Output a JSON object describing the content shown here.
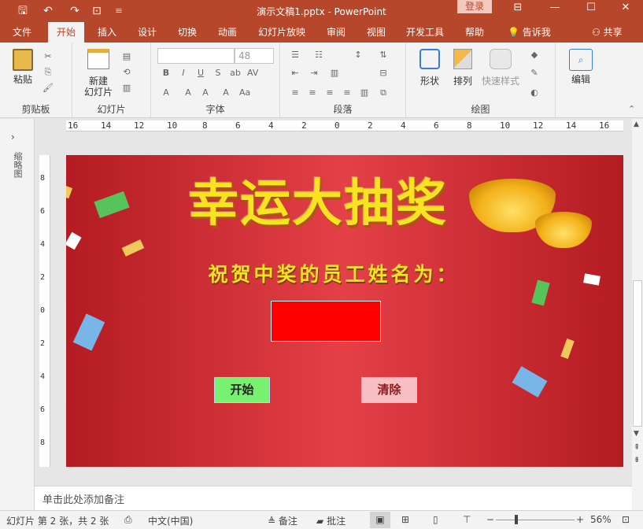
{
  "window": {
    "title": "演示文稿1.pptx - PowerPoint",
    "login_label": "登录",
    "qa_icons": [
      "save-icon",
      "undo-icon",
      "redo-icon",
      "slideshow-icon",
      "customize-icon"
    ]
  },
  "tabs": [
    "文件",
    "开始",
    "插入",
    "设计",
    "切换",
    "动画",
    "幻灯片放映",
    "审阅",
    "视图",
    "开发工具",
    "帮助"
  ],
  "active_tab": "开始",
  "tell_me": "告诉我",
  "share": "共享",
  "ribbon": {
    "clipboard": {
      "label": "剪贴板",
      "paste": "粘贴"
    },
    "slides": {
      "label": "幻灯片",
      "new_slide_line1": "新建",
      "new_slide_line2": "幻灯片"
    },
    "font": {
      "label": "字体",
      "font_name": "",
      "font_size": "48"
    },
    "paragraph": {
      "label": "段落"
    },
    "drawing": {
      "label": "绘图",
      "shapes": "形状",
      "arrange": "排列",
      "quick_styles": "快速样式"
    },
    "editing": {
      "label": "编辑"
    }
  },
  "thumbnails_label": "缩略图",
  "ruler": {
    "h_ticks": [
      "16",
      "14",
      "12",
      "10",
      "8",
      "6",
      "4",
      "2",
      "0",
      "2",
      "4",
      "6",
      "8",
      "10",
      "12",
      "14",
      "16"
    ],
    "v_ticks": [
      "8",
      "6",
      "4",
      "2",
      "0",
      "2",
      "4",
      "6",
      "8"
    ]
  },
  "slide": {
    "title": "幸运大抽奖",
    "subtitle": "祝贺中奖的员工姓名为：",
    "winner_name": "",
    "start_button": "开始",
    "clear_button": "清除",
    "colors": {
      "background": "#c8262c",
      "title": "#f7e31f",
      "name_box": "#ff0000",
      "start": "#77f16f",
      "clear": "#f7bfc4"
    }
  },
  "notes_placeholder": "单击此处添加备注",
  "status": {
    "slide_info": "幻灯片 第 2 张，共 2 张",
    "language": "中文(中国)",
    "notes": "备注",
    "comments": "批注",
    "zoom": "56%"
  }
}
